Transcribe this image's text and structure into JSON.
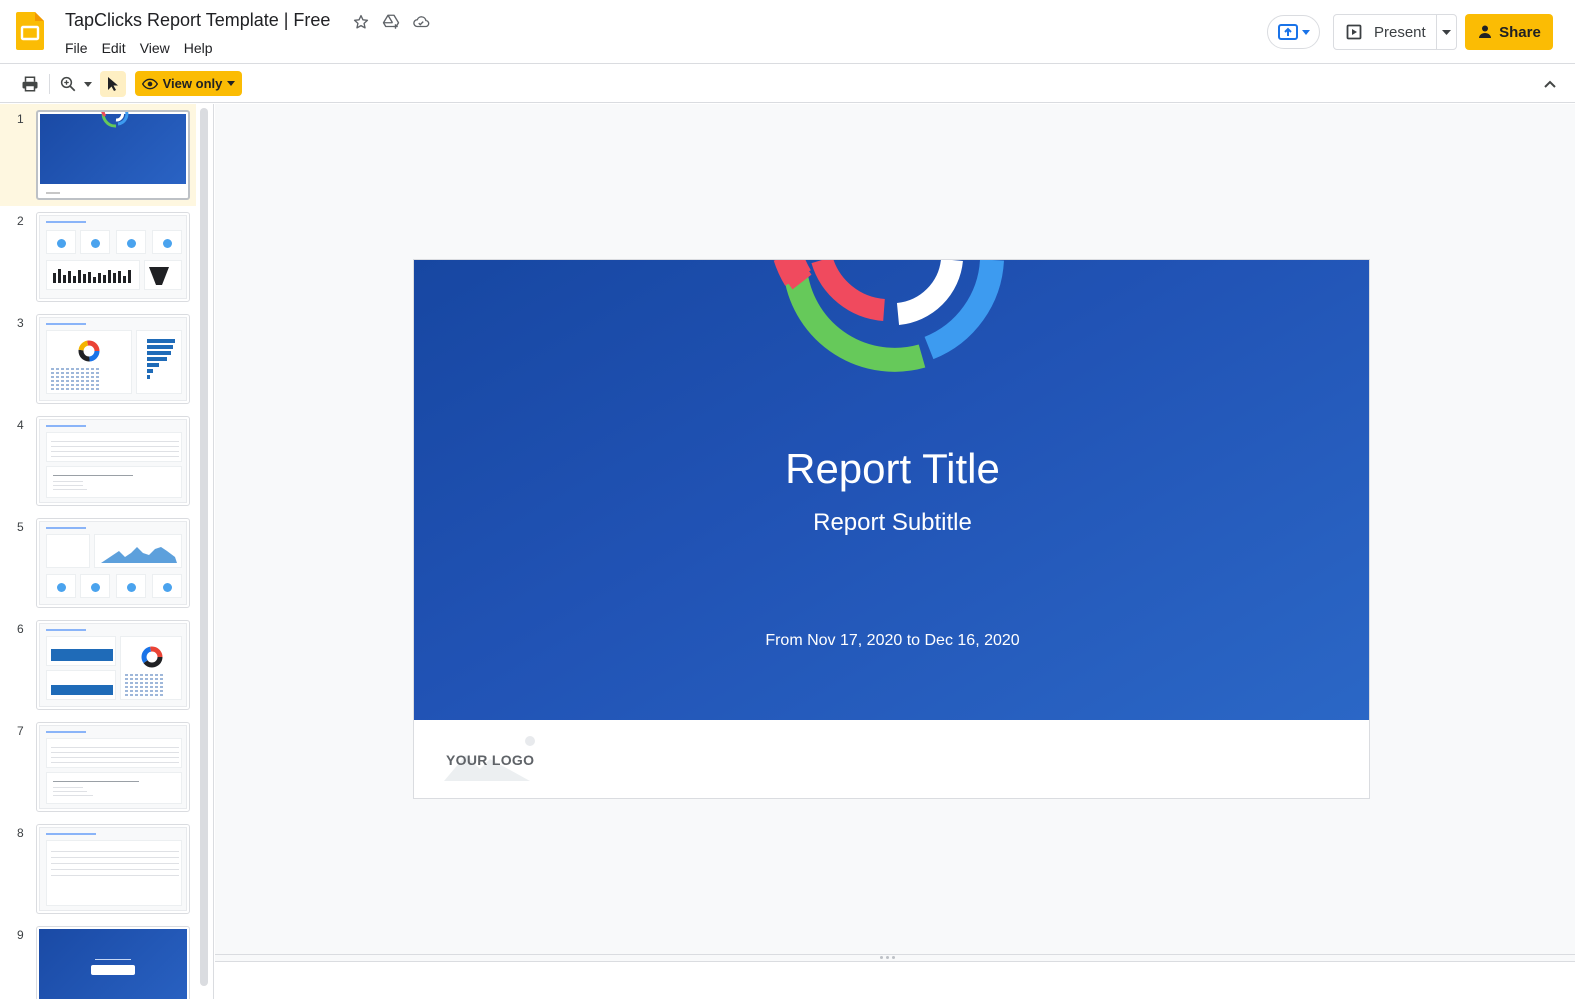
{
  "document": {
    "title": "TapClicks Report Template | Free"
  },
  "menu": {
    "items": [
      "File",
      "Edit",
      "View",
      "Help"
    ]
  },
  "header": {
    "present_label": "Present",
    "share_label": "Share"
  },
  "toolbar": {
    "mode_label": "View only"
  },
  "filmstrip": {
    "slides": [
      {
        "number": "1",
        "selected": true
      },
      {
        "number": "2"
      },
      {
        "number": "3"
      },
      {
        "number": "4"
      },
      {
        "number": "5"
      },
      {
        "number": "6"
      },
      {
        "number": "7"
      },
      {
        "number": "8"
      },
      {
        "number": "9"
      }
    ]
  },
  "slide": {
    "title": "Report Title",
    "subtitle": "Report Subtitle",
    "date_range": "From Nov 17, 2020 to Dec 16, 2020",
    "logo_text": "YOUR LOGO"
  },
  "colors": {
    "accent": "#fbbc04",
    "slide_blue": "#1f52b3",
    "ring_red": "#f04a5e",
    "ring_green": "#66c95a",
    "ring_white": "#ffffff",
    "ring_blue": "#3d9bf0"
  },
  "icons": {
    "app": "slides-icon",
    "star": "star-icon",
    "drive": "drive-add-icon",
    "cloud": "cloud-saved-icon",
    "print": "print-icon",
    "zoom": "zoom-icon",
    "select": "cursor-icon",
    "view": "eye-icon"
  }
}
